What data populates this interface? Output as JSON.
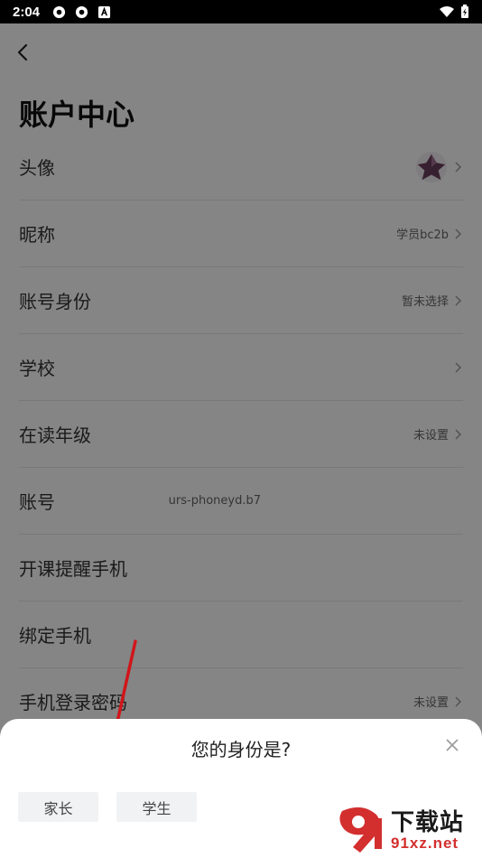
{
  "status_bar": {
    "time": "2:04"
  },
  "header": {
    "title": "账户中心"
  },
  "rows": [
    {
      "label": "头像",
      "value": ""
    },
    {
      "label": "昵称",
      "value": "学员bc2b"
    },
    {
      "label": "账号身份",
      "value": "暂未选择"
    },
    {
      "label": "学校",
      "value": ""
    },
    {
      "label": "在读年级",
      "value": "未设置"
    },
    {
      "label": "账号",
      "value": "urs-phoneyd.b7"
    },
    {
      "label": "开课提醒手机",
      "value": ""
    },
    {
      "label": "绑定手机",
      "value": ""
    },
    {
      "label": "手机登录密码",
      "value": "未设置"
    }
  ],
  "dialog": {
    "question": "您的身份是?",
    "options": [
      "家长",
      "学生"
    ]
  },
  "watermark": {
    "text": "下载站",
    "url": "91xz.net"
  },
  "colors": {
    "annotation_arrow": "#d0161b",
    "overlay": "#000000"
  }
}
